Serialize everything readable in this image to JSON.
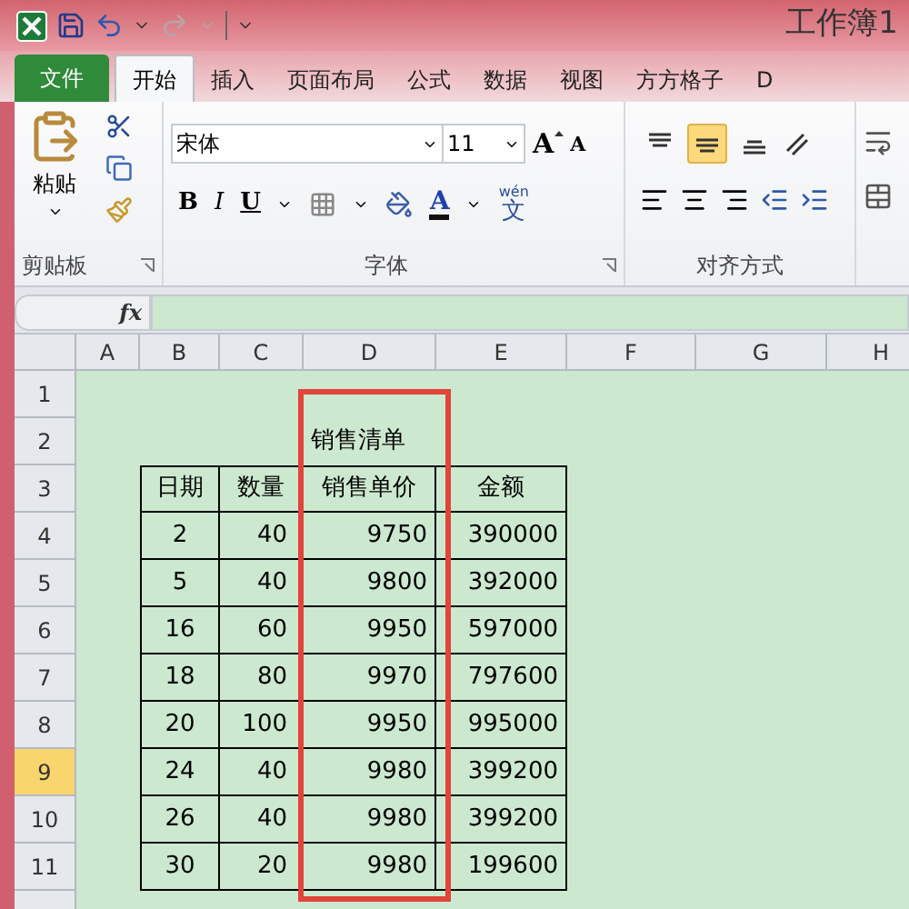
{
  "window": {
    "title": "工作簿1"
  },
  "tabs": [
    {
      "label": "文件",
      "kind": "file",
      "selected": false
    },
    {
      "label": "开始",
      "kind": "tab",
      "selected": true
    },
    {
      "label": "插入",
      "kind": "tab",
      "selected": false
    },
    {
      "label": "页面布局",
      "kind": "tab",
      "selected": false
    },
    {
      "label": "公式",
      "kind": "tab",
      "selected": false
    },
    {
      "label": "数据",
      "kind": "tab",
      "selected": false
    },
    {
      "label": "视图",
      "kind": "tab",
      "selected": false
    },
    {
      "label": "方方格子",
      "kind": "tab",
      "selected": false
    },
    {
      "label": "D",
      "kind": "tab",
      "selected": false
    }
  ],
  "ribbon": {
    "clipboard": {
      "paste": "粘贴",
      "label": "剪贴板"
    },
    "font": {
      "name": "宋体",
      "size": "11",
      "grow": "A",
      "shrink": "A",
      "bold": "B",
      "italic": "I",
      "underline": "U",
      "color_letter": "A",
      "phonetic_top": "wén",
      "phonetic_char": "文",
      "label": "字体"
    },
    "alignment": {
      "vertical": [
        {
          "selected": false
        },
        {
          "selected": true
        },
        {
          "selected": false
        }
      ],
      "label": "对齐方式"
    }
  },
  "formula_bar": {
    "fx": "fx"
  },
  "columns": [
    {
      "label": "A"
    },
    {
      "label": "B"
    },
    {
      "label": "C"
    },
    {
      "label": "D"
    },
    {
      "label": "E"
    },
    {
      "label": "F"
    },
    {
      "label": "G"
    },
    {
      "label": "H"
    }
  ],
  "row_headers": [
    {
      "label": "1",
      "selected": false
    },
    {
      "label": "2",
      "selected": false
    },
    {
      "label": "3",
      "selected": false
    },
    {
      "label": "4",
      "selected": false
    },
    {
      "label": "5",
      "selected": false
    },
    {
      "label": "6",
      "selected": false
    },
    {
      "label": "7",
      "selected": false
    },
    {
      "label": "8",
      "selected": false
    },
    {
      "label": "9",
      "selected": true
    },
    {
      "label": "10",
      "selected": false
    },
    {
      "label": "11",
      "selected": false
    }
  ],
  "table": {
    "title": "销售清单",
    "header": [
      "日期",
      "数量",
      "销售单价",
      "金额"
    ],
    "rows": [
      [
        "2",
        "40",
        "9750",
        "390000"
      ],
      [
        "5",
        "40",
        "9800",
        "392000"
      ],
      [
        "16",
        "60",
        "9950",
        "597000"
      ],
      [
        "18",
        "80",
        "9970",
        "797600"
      ],
      [
        "20",
        "100",
        "9950",
        "995000"
      ],
      [
        "24",
        "40",
        "9980",
        "399200"
      ],
      [
        "26",
        "40",
        "9980",
        "399200"
      ],
      [
        "30",
        "20",
        "9980",
        "199600"
      ]
    ]
  }
}
